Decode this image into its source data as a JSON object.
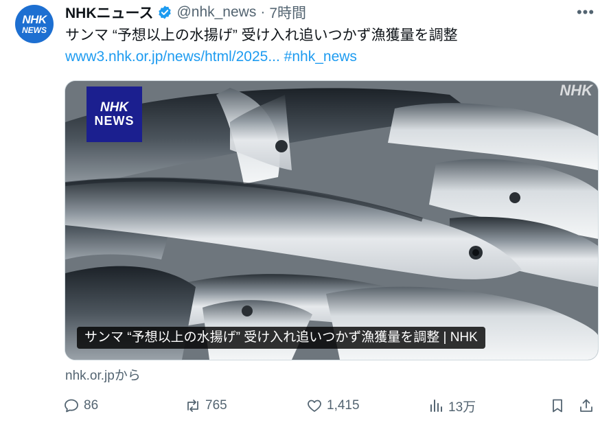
{
  "avatar": {
    "line1": "NHK",
    "line2": "NEWS"
  },
  "header": {
    "display_name": "NHKニュース",
    "handle": "@nhk_news",
    "separator": "·",
    "time": "7時間",
    "more_icon": "more-dots-icon"
  },
  "tweet": {
    "text": "サンマ “予想以上の水揚げ” 受け入れ追いつかず漁獲量を調整",
    "link": "www3.nhk.or.jp/news/html/2025...",
    "hashtag": "#nhk_news"
  },
  "media": {
    "badge_line1": "NHK",
    "badge_line2": "NEWS",
    "watermark": "NHK",
    "caption": "サンマ “予想以上の水揚げ” 受け入れ追いつかず漁獲量を調整 | NHK"
  },
  "source": "nhk.or.jpから",
  "actions": {
    "reply_count": "86",
    "retweet_count": "765",
    "like_count": "1,415",
    "views_count": "13万"
  },
  "colors": {
    "link": "#1d9bf0",
    "secondary_text": "#536471",
    "verified": "#1d9bf0",
    "avatar_bg": "#1d6fd1",
    "badge_bg": "#1b1f8f"
  }
}
